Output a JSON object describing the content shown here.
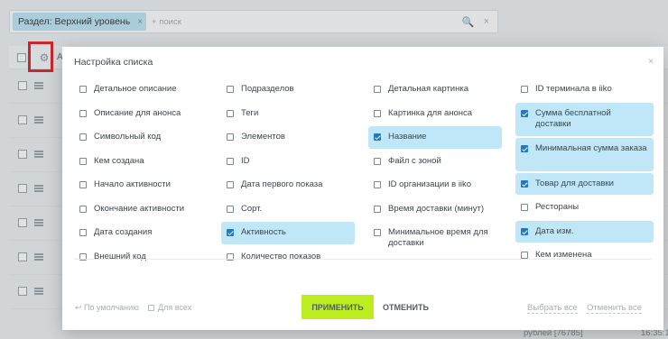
{
  "filter": {
    "chip_label": "Раздел: Верхний уровень",
    "chip_close": "×",
    "search_placeholder": "+ поиск",
    "search_icon": "🔍",
    "clear_icon": "×"
  },
  "list": {
    "header_letter": "А",
    "row_count": 7,
    "footer_text": "рублей [76785]",
    "footer_time": "16:35:1"
  },
  "dialog": {
    "title": "Настройка списка",
    "close": "×",
    "columns": [
      [
        {
          "label": "Детальное описание",
          "checked": false
        },
        {
          "label": "Описание для анонса",
          "checked": false
        },
        {
          "label": "Символьный код",
          "checked": false
        },
        {
          "label": "Кем создана",
          "checked": false
        },
        {
          "label": "Начало активности",
          "checked": false
        },
        {
          "label": "Окончание активности",
          "checked": false
        },
        {
          "label": "Дата создания",
          "checked": false
        },
        {
          "label": "Внешний код",
          "checked": false
        }
      ],
      [
        {
          "label": "Подразделов",
          "checked": false
        },
        {
          "label": "Теги",
          "checked": false
        },
        {
          "label": "Элементов",
          "checked": false
        },
        {
          "label": "ID",
          "checked": false
        },
        {
          "label": "Дата первого показа",
          "checked": false
        },
        {
          "label": "Сорт.",
          "checked": false
        },
        {
          "label": "Активность",
          "checked": true
        },
        {
          "label": "Количество показов",
          "checked": false
        }
      ],
      [
        {
          "label": "Детальная картинка",
          "checked": false
        },
        {
          "label": "Картинка для анонса",
          "checked": false
        },
        {
          "label": "Название",
          "checked": true
        },
        {
          "label": "Файл с зоной",
          "checked": false
        },
        {
          "label": "ID организации в iiko",
          "checked": false
        },
        {
          "label": "Время доставки (минут)",
          "checked": false
        },
        {
          "label": "Минимальное время для доставки",
          "checked": false
        }
      ],
      [
        {
          "label": "ID терминала в iiko",
          "checked": false
        },
        {
          "label": "Сумма бесплатной доставки",
          "checked": true
        },
        {
          "label": "Минимальная сумма заказа",
          "checked": true
        },
        {
          "label": "Товар для доставки",
          "checked": true
        },
        {
          "label": "Рестораны",
          "checked": false
        },
        {
          "label": "Дата изм.",
          "checked": true
        },
        {
          "label": "Кем изменена",
          "checked": false
        }
      ]
    ],
    "footer": {
      "default_link": "↩ По умолчанию",
      "for_all_label": "Для всех",
      "apply_button": "ПРИМЕНИТЬ",
      "cancel_button": "ОТМЕНИТЬ",
      "select_all": "Выбрать все",
      "deselect_all": "Отменить все"
    }
  }
}
